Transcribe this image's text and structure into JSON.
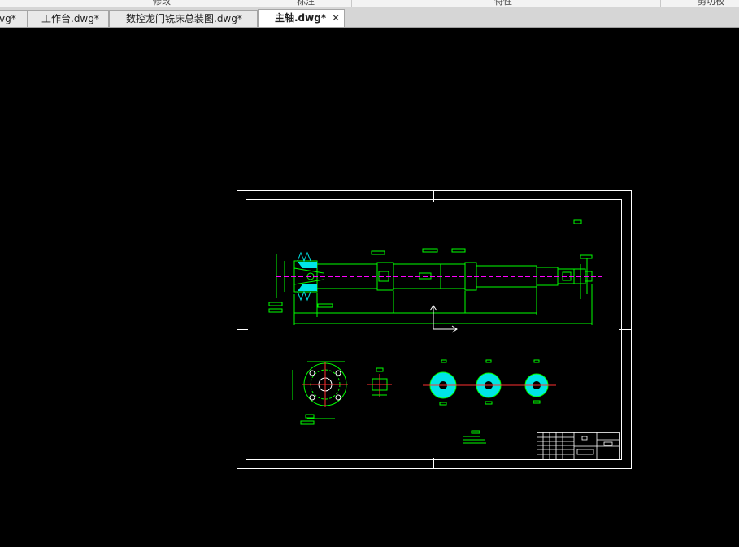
{
  "ribbon": {
    "groups": [
      "修改",
      "标注",
      "特性",
      "剪切板"
    ]
  },
  "tabs": [
    {
      "label": "vg*",
      "active": false
    },
    {
      "label": "工作台.dwg*",
      "active": false
    },
    {
      "label": "数控龙门铣床总装图.dwg*",
      "active": false
    },
    {
      "label": "主轴.dwg*",
      "active": true
    }
  ],
  "tab_close_icon": "close-icon",
  "colors": {
    "canvas": "#000000",
    "drawing_lines": "#00ff00",
    "border_lines": "#ffffff",
    "centerline": "#ff3030",
    "hatch": "#00e5e5",
    "shaft_center": "#ff00ff"
  }
}
